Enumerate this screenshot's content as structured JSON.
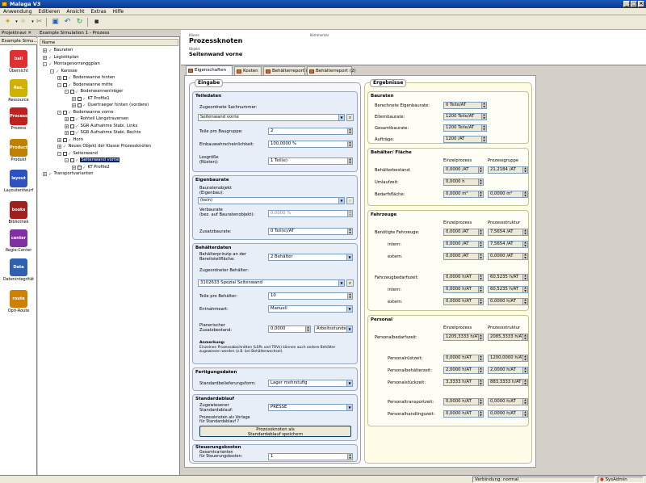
{
  "window": {
    "title": "Malaga V3"
  },
  "menu": [
    "Anwendung",
    "Editieren",
    "Ansicht",
    "Extras",
    "Hilfe"
  ],
  "leftpane": {
    "tab_label": "Projektnavi",
    "subtab": "Example Simu...",
    "items": [
      {
        "label": "Übersicht",
        "icon": "ball",
        "color": "#e03030"
      },
      {
        "label": "Ressource",
        "icon": "Res.",
        "color": "#d0b000"
      },
      {
        "label": "Prozess",
        "icon": "Process",
        "color": "#c02020"
      },
      {
        "label": "Produkt",
        "icon": "Product",
        "color": "#c08000"
      },
      {
        "label": "Layoutentwurf",
        "icon": "layout",
        "color": "#3050c0"
      },
      {
        "label": "Bibliothek",
        "icon": "books",
        "color": "#a02020"
      },
      {
        "label": "Regie-Center",
        "icon": "center",
        "color": "#8030a0"
      },
      {
        "label": "Datenintegrität",
        "icon": "Data Quality",
        "color": "#3060b0"
      },
      {
        "label": "Opti-Route",
        "icon": "route",
        "color": "#d08000"
      }
    ]
  },
  "tree": {
    "tab_label": "Example Simulation 1 - Prozess",
    "column_header": "Name",
    "rows": [
      {
        "label": "Bauraten",
        "indent": 0,
        "pm": "+",
        "ck": false,
        "tick": true
      },
      {
        "label": "Logistikplan",
        "indent": 0,
        "pm": "+",
        "ck": false,
        "tick": true
      },
      {
        "label": "Montagevorranggplan",
        "indent": 0,
        "pm": "-",
        "ck": false,
        "tick": true
      },
      {
        "label": "Karosse",
        "indent": 1,
        "pm": "-",
        "ck": false,
        "tick": true
      },
      {
        "label": "Bodenwanne hinten",
        "indent": 2,
        "pm": "+",
        "ck": true,
        "tick": true
      },
      {
        "label": "Bodenwanne mitte",
        "indent": 2,
        "pm": "-",
        "ck": true,
        "tick": true
      },
      {
        "label": "Bodenwannenträger",
        "indent": 3,
        "pm": "-",
        "ck": true,
        "tick": true
      },
      {
        "label": "KT Profile1",
        "indent": 4,
        "pm": "+",
        "ck": true,
        "tick": true
      },
      {
        "label": "Quertraeger hinten (vordere)",
        "indent": 4,
        "pm": "+",
        "ck": true,
        "tick": true
      },
      {
        "label": "Bodenwanne vorne",
        "indent": 2,
        "pm": "-",
        "ck": true,
        "tick": true
      },
      {
        "label": "Rohteil Längstraversen",
        "indent": 3,
        "pm": "+",
        "ck": true,
        "tick": true
      },
      {
        "label": "SGR Aufnahme Stabi. Links",
        "indent": 3,
        "pm": "+",
        "ck": true,
        "tick": true
      },
      {
        "label": "SGR Aufnahme Stabi. Rechts",
        "indent": 3,
        "pm": "+",
        "ck": true,
        "tick": true
      },
      {
        "label": "Horn",
        "indent": 2,
        "pm": "+",
        "ck": true,
        "tick": true
      },
      {
        "label": "Neues Objekt der Klasse Prozessknoten",
        "indent": 2,
        "pm": "+",
        "ck": false,
        "tick": true
      },
      {
        "label": "Seitenwand",
        "indent": 2,
        "pm": "-",
        "ck": true,
        "tick": true
      },
      {
        "label": "Seitenwand vorne",
        "indent": 3,
        "pm": "-",
        "ck": true,
        "tick": true,
        "selected": true
      },
      {
        "label": "KT Profile2",
        "indent": 4,
        "pm": "+",
        "ck": true,
        "tick": true
      },
      {
        "label": "Transportvarianten",
        "indent": 0,
        "pm": "+",
        "ck": false,
        "tick": true
      }
    ]
  },
  "header": {
    "class_caption": "Klasse",
    "class_name": "Prozessknoten",
    "kommentar": "Kommentar",
    "object_caption": "Objekt",
    "object_name": "Seitenwand vorne"
  },
  "tabs": [
    "Eigenschaften",
    "Kosten",
    "Behälterreport (1)",
    "Behälterreport (2)"
  ],
  "eingabe": {
    "title": "Eingabe",
    "teiledaten": {
      "title": "Teiledaten",
      "sachnummer_label": "Zugeordnete Sachnummer:",
      "sachnummer_value": "Seitenwand vorne",
      "teile_pro_baugruppe_label": "Teile pro Baugruppe:",
      "teile_pro_baugruppe_value": "2",
      "einbauwahrscheinlichkeit_label": "Einbauwahrscheinlichkeit:",
      "einbauwahrscheinlichkeit_value": "100,0000 %",
      "losgroesse_label": "Losgröße\n(Rüsten):",
      "losgroesse_value": "1 Teil(e)"
    },
    "eigenbaurate": {
      "title": "Eigenbaurate",
      "bauratenobjekt_label": "Bauratenobjekt\n(Eigenbau):",
      "bauratenobjekt_value": "(kein)",
      "verbaurate_label": "Verbaurate\n(bez. auf Bauratenobjekt):",
      "verbaurate_value": "0,0000 %",
      "zusatzbaurate_label": "Zusatzbaurate:",
      "zusatzbaurate_value": "0 Teil(e)/AT"
    },
    "behaelterdaten": {
      "title": "Behälterdaten",
      "prinzip_label": "Behälterprinzip an der\nBereitstellfläche:",
      "prinzip_value": "2 Behälter",
      "zugeordneter_label": "Zugeordneter Behälter:",
      "zugeordneter_value": "3102633 Spezial Seitenwand",
      "teile_pro_behaelter_label": "Teile pro Behälter:",
      "teile_pro_behaelter_value": "10",
      "entnahmeart_label": "Entnahmeart:",
      "entnahmeart_value": "Manuell",
      "planerischer_label": "Planerischer\nZusatzbestand:",
      "planerischer_value": "0,0000",
      "planerischer_unit": "Arbeitsstunde(n)",
      "anmerkung_title": "Anmerkung:",
      "anmerkung_text": "Einzelnen Prozessabschnitten (LSPs und TRVs) können auch andere Behälter zugewiesen werden (z.B. bei Behälterwechsel)."
    },
    "fertigungsdaten": {
      "title": "Fertigungsdaten",
      "standardbelieferungsform_label": "Standardbelieferungsform:",
      "standardbelieferungsform_value": "Lager mehrstufig"
    },
    "standardablauf": {
      "title": "Standardablauf",
      "zugewiesener_label": "Zugewiesener\nStandardablauf:",
      "zugewiesener_value": "PRESSE",
      "vorlage_label": "Prozessknoten als Vorlage\nfür Standardablauf ?",
      "button_label": "Prozessknoten als\nStandardablauf speichern"
    },
    "steuerungskosten": {
      "title": "Steuerungskosten",
      "label": "Gesamtvarianten\nfür Steuerungskosten:",
      "value": "1"
    }
  },
  "ergebnisse": {
    "title": "Ergebnisse",
    "bauraten": {
      "title": "Bauraten",
      "rows": [
        {
          "label": "Berechnete Eigenbaurate:",
          "value": "0 Teile/AT"
        },
        {
          "label": "Elternbaurate:",
          "value": "1200 Teile/AT"
        },
        {
          "label": "Gesamtbaurate:",
          "value": "1200 Teile/AT"
        },
        {
          "label": "Aufträge:",
          "value": "1200 /AT"
        }
      ]
    },
    "behaelter_flaeche": {
      "title": "Behälter/ Fläche",
      "col1": "Einzelprozess",
      "col2": "Prozessgruppe",
      "rows": [
        {
          "label": "Behälterbestand:",
          "v1": "0,0000 /AT",
          "v2": "21,2184 /AT"
        },
        {
          "label": "Umlaufzeit:",
          "v1": "0,0000 h",
          "v2": ""
        },
        {
          "label": "Bedarfsfläche:",
          "v1": "0,0000 m²",
          "v2": "0,0000 m²"
        }
      ]
    },
    "fahrzeuge": {
      "title": "Fahrzeuge",
      "col1": "Einzelprozess",
      "col2": "Prozessstruktur",
      "rows": [
        {
          "label": "Benötigte Fahrzeuge:",
          "v1": "0,0000 /AT",
          "v2": "7,5654 /AT"
        },
        {
          "label": "intern:",
          "v1": "0,0000 /AT",
          "v2": "7,5654 /AT"
        },
        {
          "label": "extern:",
          "v1": "0,0000 /AT",
          "v2": "0,0000 /AT"
        },
        {
          "label": "Fahrzeugbedarfszeit:",
          "v1": "0,0000 h/AT",
          "v2": "60,5235 h/AT"
        },
        {
          "label": "intern:",
          "v1": "0,0000 h/AT",
          "v2": "60,5235 h/AT"
        },
        {
          "label": "extern:",
          "v1": "0,0000 h/AT",
          "v2": "0,0000 h/AT"
        }
      ]
    },
    "personal": {
      "title": "Personal",
      "col1": "Einzelprozess",
      "col2": "Prozessstruktur",
      "rows": [
        {
          "label": "Personalbedarfszeit:",
          "v1": "1205,3333 h/AT",
          "v2": "2085,3333 h/AT"
        },
        {
          "label": "Personalrüstzeit:",
          "v1": "0,0000 h/AT",
          "v2": "1200,0000 h/AT"
        },
        {
          "label": "Personalbehälterzeit:",
          "v1": "2,0000 h/AT",
          "v2": "2,0000 h/AT"
        },
        {
          "label": "Personalstückzeit:",
          "v1": "3,3333 h/AT",
          "v2": "883,3333 h/AT"
        },
        {
          "label": "Personaltransportzeit:",
          "v1": "0,0000 h/AT",
          "v2": "0,0000 h/AT"
        },
        {
          "label": "Personalhandlingszeit:",
          "v1": "0,0000 h/AT",
          "v2": "0,0000 h/AT"
        }
      ]
    }
  },
  "statusbar": {
    "verbindung": "Verbindung: normal",
    "user": "SysAdmin"
  }
}
